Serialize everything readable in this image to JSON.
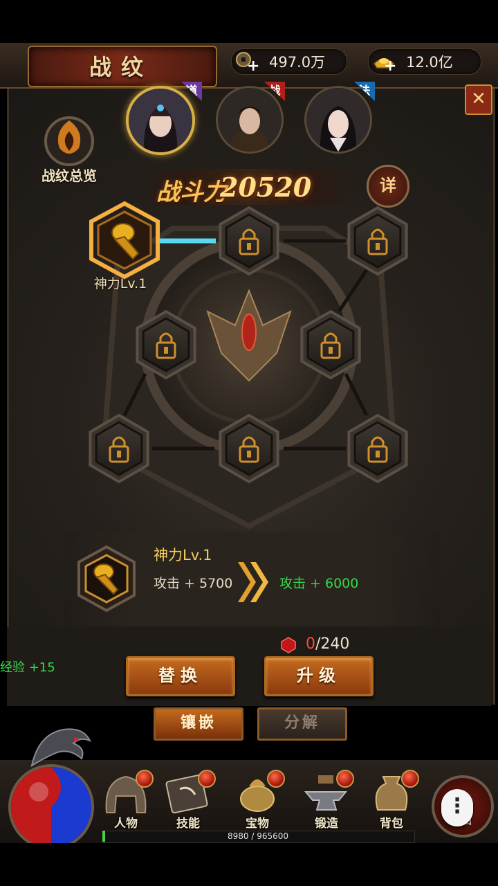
{
  "header": {
    "title": "战纹",
    "copper": "497.0万",
    "gold": "12.0亿"
  },
  "heroes": [
    {
      "role": "道",
      "color": "#6a3aa0",
      "active": true
    },
    {
      "role": "战",
      "color": "#b0201a",
      "active": false
    },
    {
      "role": "法",
      "color": "#1a6ab0",
      "active": false
    }
  ],
  "overview": {
    "label": "战纹总览"
  },
  "power": {
    "label": "战斗力",
    "value": "20520",
    "detail_label": "详"
  },
  "nodes": {
    "first": {
      "label": "神力Lv.1",
      "unlocked": true,
      "icon": "fist-icon"
    },
    "locked_icon": "lock-icon"
  },
  "info": {
    "name": "神力Lv.1",
    "current": "攻击 + 5700",
    "next": "攻击 + 6000"
  },
  "cost": {
    "current": "0",
    "total": "/240"
  },
  "exp_gain": "经验 +15",
  "buttons": {
    "replace": "替换",
    "upgrade": "升级"
  },
  "tabs": {
    "inlay": "镶嵌",
    "decompose": "分解"
  },
  "nav": [
    {
      "label": "人物",
      "icon": "helmet-icon"
    },
    {
      "label": "技能",
      "icon": "skill-book-icon"
    },
    {
      "label": "宝物",
      "icon": "treasure-icon"
    },
    {
      "label": "锻造",
      "icon": "anvil-icon"
    },
    {
      "label": "背包",
      "icon": "bag-icon"
    }
  ],
  "return_label": "返回",
  "more_label": "⋮",
  "exp_bar": {
    "current": 8980,
    "max": 965600,
    "text": "8980 / 965600"
  },
  "colors": {
    "accent": "#c46a1e",
    "gold_text": "#f2cf5e",
    "gain_green": "#33d94a",
    "cost_red": "#ff4a3a"
  }
}
